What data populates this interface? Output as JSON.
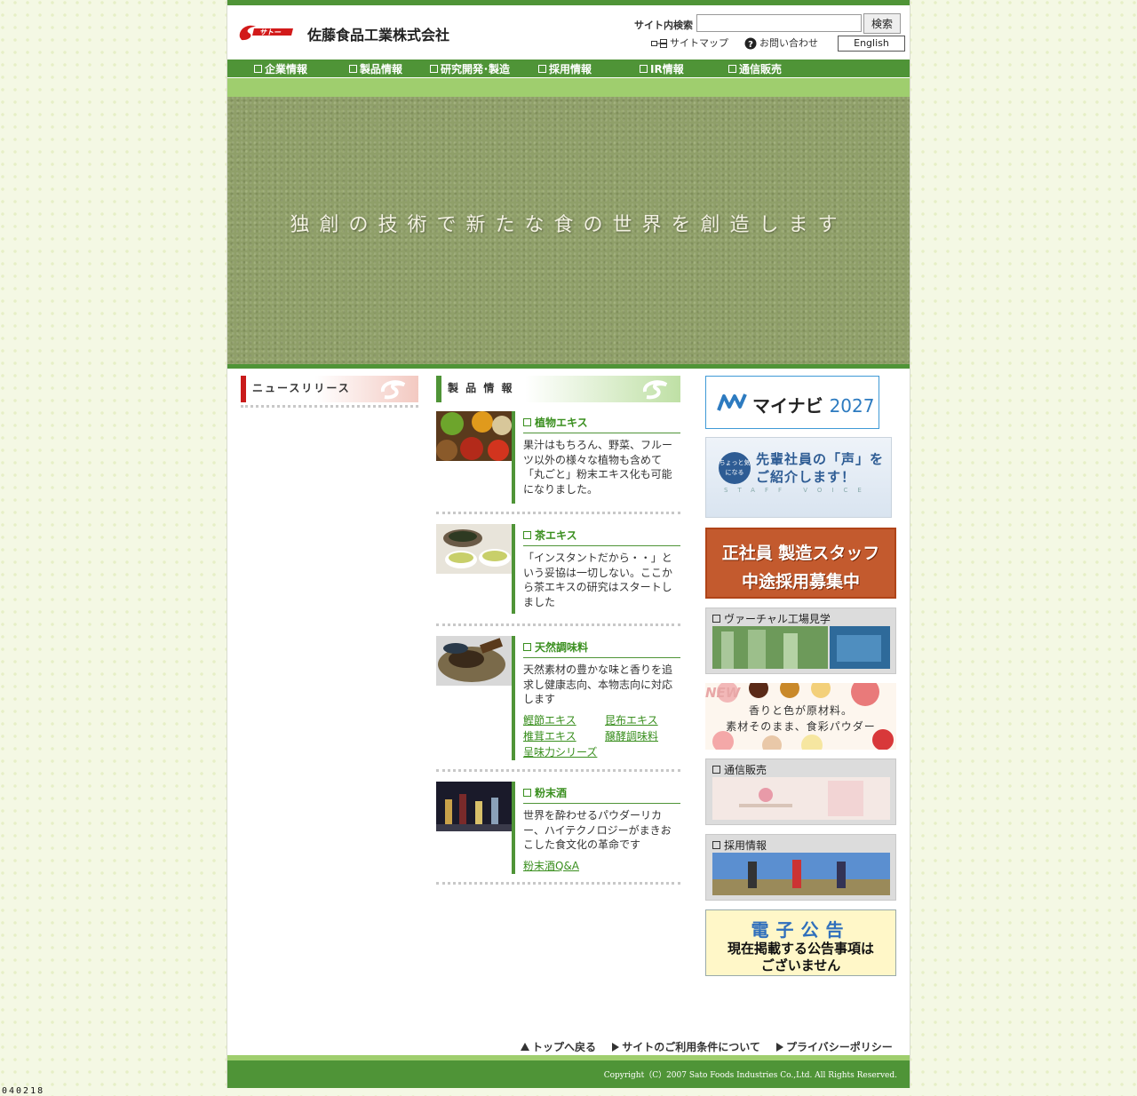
{
  "header": {
    "logo_mark": "サトー",
    "company_name": "佐藤食品工業株式会社",
    "search_label": "サイト内検索",
    "search_value": "",
    "search_button": "検索",
    "sitemap": "サイトマップ",
    "contact": "お問い合わせ",
    "english": "English"
  },
  "nav": {
    "items": [
      "企業情報",
      "製品情報",
      "研究開発･製造",
      "採用情報",
      "IR情報",
      "通信販売"
    ]
  },
  "hero": {
    "tagline": "独創の技術で新たな食の世界を創造します"
  },
  "news": {
    "title": "ニュースリリース"
  },
  "products": {
    "title": "製 品 情 報",
    "items": [
      {
        "title": "植物エキス",
        "desc": "果汁はもちろん、野菜、フルーツ以外の様々な植物も含めて「丸ごと」粉末エキス化も可能になりました。"
      },
      {
        "title": "茶エキス",
        "desc": "「インスタントだから・・」という妥協は一切しない。ここから茶エキスの研究はスタートしました"
      },
      {
        "title": "天然調味料",
        "desc": "天然素材の豊かな味と香りを追求し健康志向、本物志向に対応します",
        "links": [
          "鰹節エキス",
          "昆布エキス",
          "椎茸エキス",
          "醸酵調味料",
          "呈味力シリーズ"
        ]
      },
      {
        "title": "粉末酒",
        "desc": "世界を酔わせるパウダーリカー、ハイテクノロジーがまきおこした食文化の革命です",
        "links": [
          "粉末酒Q&A"
        ]
      }
    ]
  },
  "sidebar": {
    "mynavi": {
      "name": "マイナビ",
      "year": "2027"
    },
    "voice": {
      "badge": "ちょっと気になる",
      "line1": "先輩社員の「声」を",
      "line2": "ご紹介します！",
      "sub": "STAFF VOICE"
    },
    "recruit": {
      "line1": "正社員 製造スタッフ",
      "line2": "中途採用募集中"
    },
    "factory": "ヴァーチャル工場見学",
    "powder": {
      "new": "NEW",
      "line1": "香りと色が原材料。",
      "line2": "素材そのまま、食彩パウダー"
    },
    "mail": "通信販売",
    "jobs": "採用情報",
    "notice": {
      "title": "電子公告",
      "line1": "現在掲載する公告事項は",
      "line2": "ございません"
    }
  },
  "footer": {
    "links": [
      "トップへ戻る",
      "サイトのご利用条件について",
      "プライバシーポリシー"
    ],
    "copyright": "Copyright（C）2007 Sato Foods Industries Co.,Ltd. All Rights Reserved."
  },
  "counter": "040218",
  "colors": {
    "brand_green": "#4f9437",
    "light_green": "#9fce6e",
    "accent_red": "#c91b1b",
    "link_green": "#3a8f1f"
  }
}
